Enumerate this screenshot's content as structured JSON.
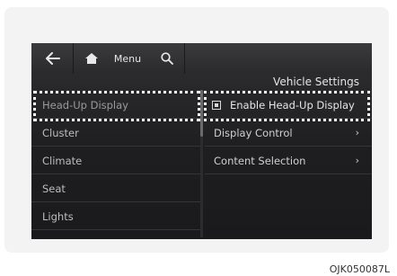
{
  "topbar": {
    "back_icon": "back-arrow-icon",
    "home_icon": "home-icon",
    "menu_label": "Menu",
    "search_icon": "search-icon"
  },
  "panel": {
    "title": "Vehicle Settings"
  },
  "left_menu": {
    "items": [
      {
        "label": "Head-Up Display"
      },
      {
        "label": "Cluster"
      },
      {
        "label": "Climate"
      },
      {
        "label": "Seat"
      },
      {
        "label": "Lights"
      }
    ]
  },
  "right_menu": {
    "enable_label": "Enable Head-Up Display",
    "enable_checked": true,
    "items": [
      {
        "label": "Display Control",
        "chevron": "›"
      },
      {
        "label": "Content Selection",
        "chevron": "›"
      }
    ]
  },
  "caption": "OJK050087L",
  "colors": {
    "highlight": "#ffffff",
    "screen_bg": "#1e1e20"
  }
}
